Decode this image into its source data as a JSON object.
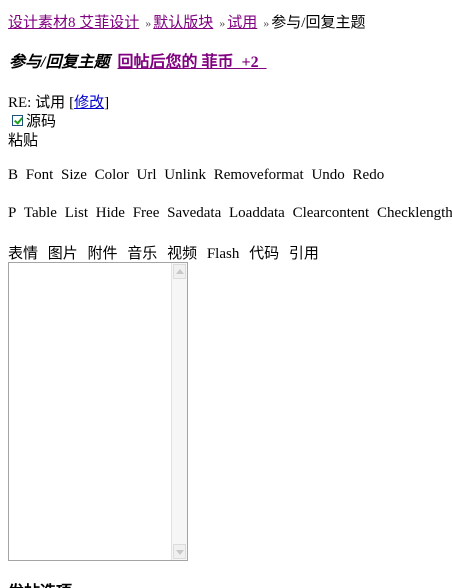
{
  "breadcrumb": {
    "items": [
      {
        "label": "设计素材8 艾菲设计"
      },
      {
        "label": "默认版块"
      },
      {
        "label": "试用"
      },
      {
        "label": "参与/回复主题"
      }
    ],
    "separator": "»"
  },
  "title": {
    "mode": "参与/回复主题",
    "reward_label": "回帖后您的 菲币",
    "reward_value": "+2"
  },
  "subject": {
    "text": "RE: 试用",
    "edit_open": "[",
    "edit_label": "修改",
    "edit_close": "]"
  },
  "source_mode": {
    "label": "源码",
    "checked": true
  },
  "paste_label": "粘贴",
  "toolbar_row1": [
    "B",
    "Font",
    "Size",
    "Color",
    "Url",
    "Unlink",
    "Removeformat",
    "Undo",
    "Redo"
  ],
  "toolbar_row2": [
    "P",
    "Table",
    "List",
    "Hide",
    "Free",
    "Savedata",
    "Loaddata",
    "Clearcontent",
    "Checklength"
  ],
  "toolbar_row3": [
    "表情",
    "图片",
    "附件",
    "音乐",
    "视频",
    "Flash",
    "代码",
    "引用"
  ],
  "editor": {
    "value": ""
  },
  "post_options_label": "发帖选项"
}
